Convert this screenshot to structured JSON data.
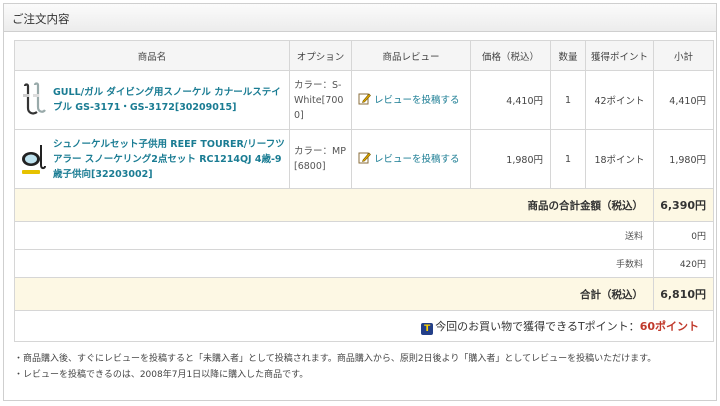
{
  "panel": {
    "title": "ご注文内容"
  },
  "table": {
    "headers": [
      "商品名",
      "オプション",
      "商品レビュー",
      "価格（税込）",
      "数量",
      "獲得ポイント",
      "小計"
    ],
    "items": [
      {
        "name": "GULL/ガル ダイビング用スノーケル カナールステイブル GS-3171・GS-3172[30209015]",
        "option": "カラー：S-White[7000]",
        "review": "レビューを投稿する",
        "price": "4,410円",
        "qty": "1",
        "points": "42ポイント",
        "subtotal": "4,410円",
        "thumb_icon": "snorkel-icon"
      },
      {
        "name": "シュノーケルセット子供用 REEF TOURER/リーフツアラー スノーケリング2点セット RC1214QJ 4歳-9歳子供向[32203002]",
        "option": "カラー：MP[6800]",
        "review": "レビューを投稿する",
        "price": "1,980円",
        "qty": "1",
        "points": "18ポイント",
        "subtotal": "1,980円",
        "thumb_icon": "snorkel-set-icon"
      }
    ],
    "product_total": {
      "label": "商品の合計金額（税込）",
      "value": "6,390円"
    },
    "shipping": {
      "label": "送料",
      "value": "0円"
    },
    "fee": {
      "label": "手数料",
      "value": "420円"
    },
    "grand_total": {
      "label": "合計（税込）",
      "value": "6,810円"
    },
    "tpoint": {
      "text": "今回のお買い物で獲得できるTポイント：",
      "value": "60ポイント",
      "icon": "t-point-icon"
    }
  },
  "notes": [
    "・商品購入後、すぐにレビューを投稿すると「未購入者」として投稿されます。商品購入から、原則2日後より「購入者」としてレビューを投稿いただけます。",
    "・レビューを投稿できるのは、2008年7月1日以降に購入した商品です。"
  ],
  "colors": {
    "link": "#1a7c93",
    "summary_bg": "#fdf8e4",
    "point_accent": "#c0392b"
  }
}
